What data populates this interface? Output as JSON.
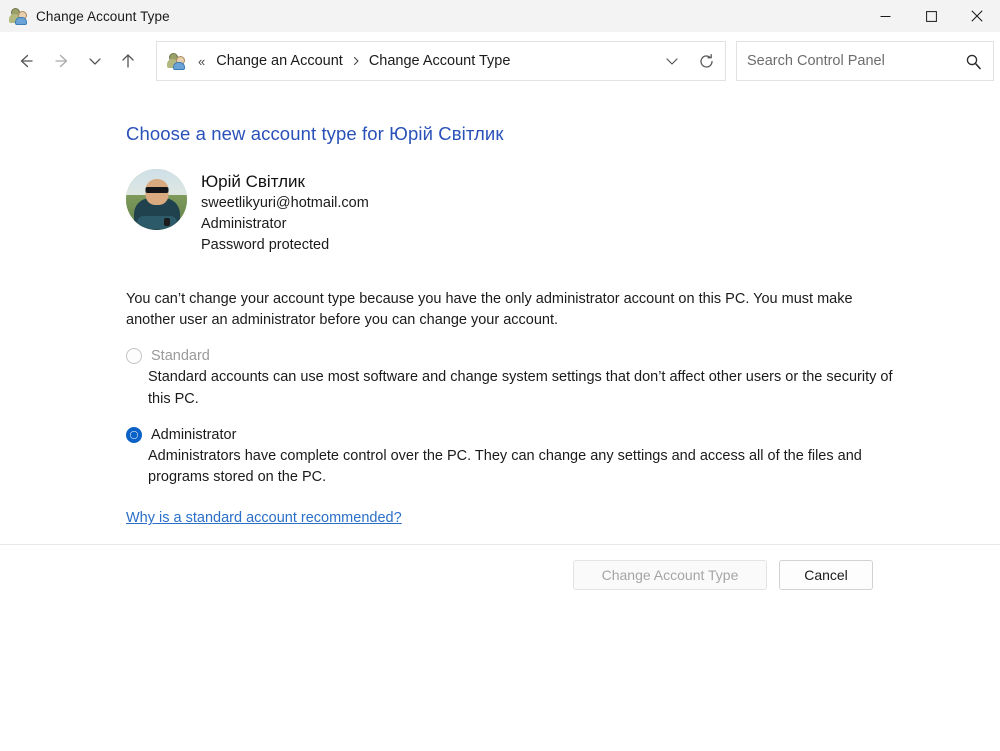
{
  "window": {
    "title": "Change Account Type",
    "icon": "user-accounts-icon",
    "minimize_label": "Minimize",
    "maximize_label": "Maximize",
    "close_label": "Close"
  },
  "nav": {
    "back_label": "Back",
    "forward_label": "Forward",
    "recent_label": "Recent locations",
    "up_label": "Up one level",
    "overflow": "«",
    "breadcrumbs": [
      {
        "label": "Change an Account"
      },
      {
        "label": "Change Account Type"
      }
    ],
    "dropdown_label": "Previous locations",
    "refresh_label": "Refresh"
  },
  "search": {
    "placeholder": "Search Control Panel",
    "value": "",
    "icon": "search-icon"
  },
  "main": {
    "heading": "Choose a new account type for Юрій Світлик",
    "user": {
      "name": "Юрій Світлик",
      "email": "sweetlikyuri@hotmail.com",
      "account_type": "Administrator",
      "password_status": "Password protected"
    },
    "notice": "You can’t change your account type because you have the only administrator account on this PC. You must make another user an administrator before you can change your account.",
    "options": [
      {
        "label": "Standard",
        "selected": false,
        "disabled": true,
        "description": "Standard accounts can use most software and change system settings that don’t affect other users or the security of this PC."
      },
      {
        "label": "Administrator",
        "selected": true,
        "disabled": false,
        "description": "Administrators have complete control over the PC. They can change any settings and access all of the files and programs stored on the PC."
      }
    ],
    "help_link": "Why is a standard account recommended?"
  },
  "footer": {
    "primary_button": "Change Account Type",
    "primary_disabled": true,
    "cancel_button": "Cancel"
  },
  "colors": {
    "heading_blue": "#2a51b8",
    "link_blue": "#2a6fc9",
    "radio_blue": "#0a62c8",
    "titlebar_bg": "#f3f3f3",
    "disabled_text": "#9a9a9a"
  }
}
